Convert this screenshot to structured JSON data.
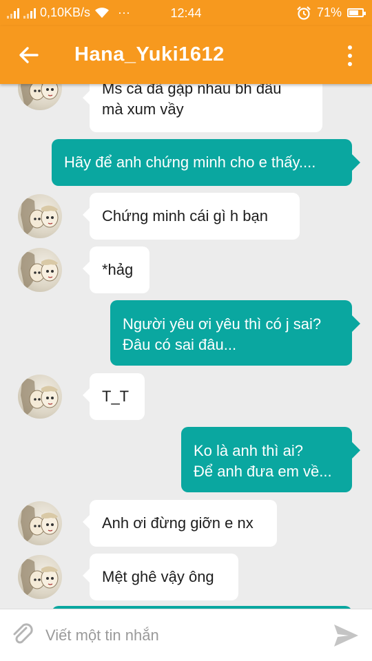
{
  "status_bar": {
    "network_speed": "0,10KB/s",
    "more": "···",
    "time": "12:44",
    "battery": "71%",
    "battery_level": 0.71
  },
  "header": {
    "title": "Hana_Yuki1612"
  },
  "messages": [
    {
      "from": "them",
      "lines": [
        "Ms cá đã gặp nhau bh đâu",
        "mà xum vầy"
      ]
    },
    {
      "from": "me",
      "lines": [
        "Hãy để anh chứng minh cho e thấy...."
      ]
    },
    {
      "from": "them",
      "lines": [
        "Chứng minh cái gì h bạn"
      ]
    },
    {
      "from": "them",
      "lines": [
        "*hảg"
      ]
    },
    {
      "from": "me",
      "lines": [
        "Người yêu ơi yêu thì có j sai?",
        "Đâu có sai đâu..."
      ]
    },
    {
      "from": "them",
      "lines": [
        "T_T"
      ]
    },
    {
      "from": "me",
      "lines": [
        "Ko là anh thì ai?",
        "Để anh đưa em về..."
      ]
    },
    {
      "from": "them",
      "lines": [
        "Anh ơi đừng giỡn e nx"
      ]
    },
    {
      "from": "them",
      "lines": [
        "Mệt ghê vậy ông"
      ]
    },
    {
      "from": "me",
      "lines": []
    }
  ],
  "composer": {
    "placeholder": "Viết một tin nhắn",
    "value": ""
  },
  "colors": {
    "header": "#f7991e",
    "sent_bubble": "#0aa7a0",
    "received_bubble": "#ffffff",
    "background": "#ececec"
  },
  "icons": {
    "back": "arrow-left-icon",
    "menu": "more-vertical-icon",
    "attach": "paperclip-icon",
    "send": "send-icon"
  }
}
